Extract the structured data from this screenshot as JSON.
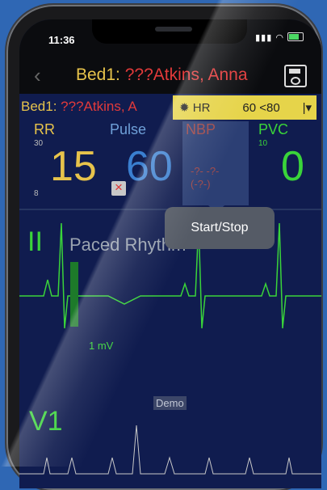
{
  "status": {
    "time": "11:36",
    "battery": "battery-icon",
    "wifi": "wifi-icon",
    "signal": "signal-icon"
  },
  "nav": {
    "title_prefix": "Bed1: ",
    "title_name": "???Atkins, Anna"
  },
  "monitor": {
    "bedline_prefix": "Bed1: ",
    "bedline_name": "???Atkins, A",
    "hr_label": "HR",
    "hr_high": "60",
    "hr_low": "<80",
    "hr_dropdown": "|▾",
    "rr": {
      "label": "RR",
      "value": "15",
      "high": "30",
      "low": "8"
    },
    "pulse": {
      "label": "Pulse",
      "value": "60"
    },
    "nbp": {
      "label": "NBP",
      "dash1": "-?- -?-",
      "dash2": "(-?-)"
    },
    "pvc": {
      "label": "PVC",
      "value": "0",
      "limit": "10"
    },
    "lead1": "II",
    "rhythm": "Paced Rhythm",
    "scale": "1 mV",
    "demo": "Demo",
    "lead2": "V1",
    "tooltip": "Start/Stop"
  },
  "colors": {
    "accent": "#e7c34b",
    "name_red": "#e23a3a",
    "ecg_green": "#3ad43a",
    "bg": "#101c4f"
  }
}
